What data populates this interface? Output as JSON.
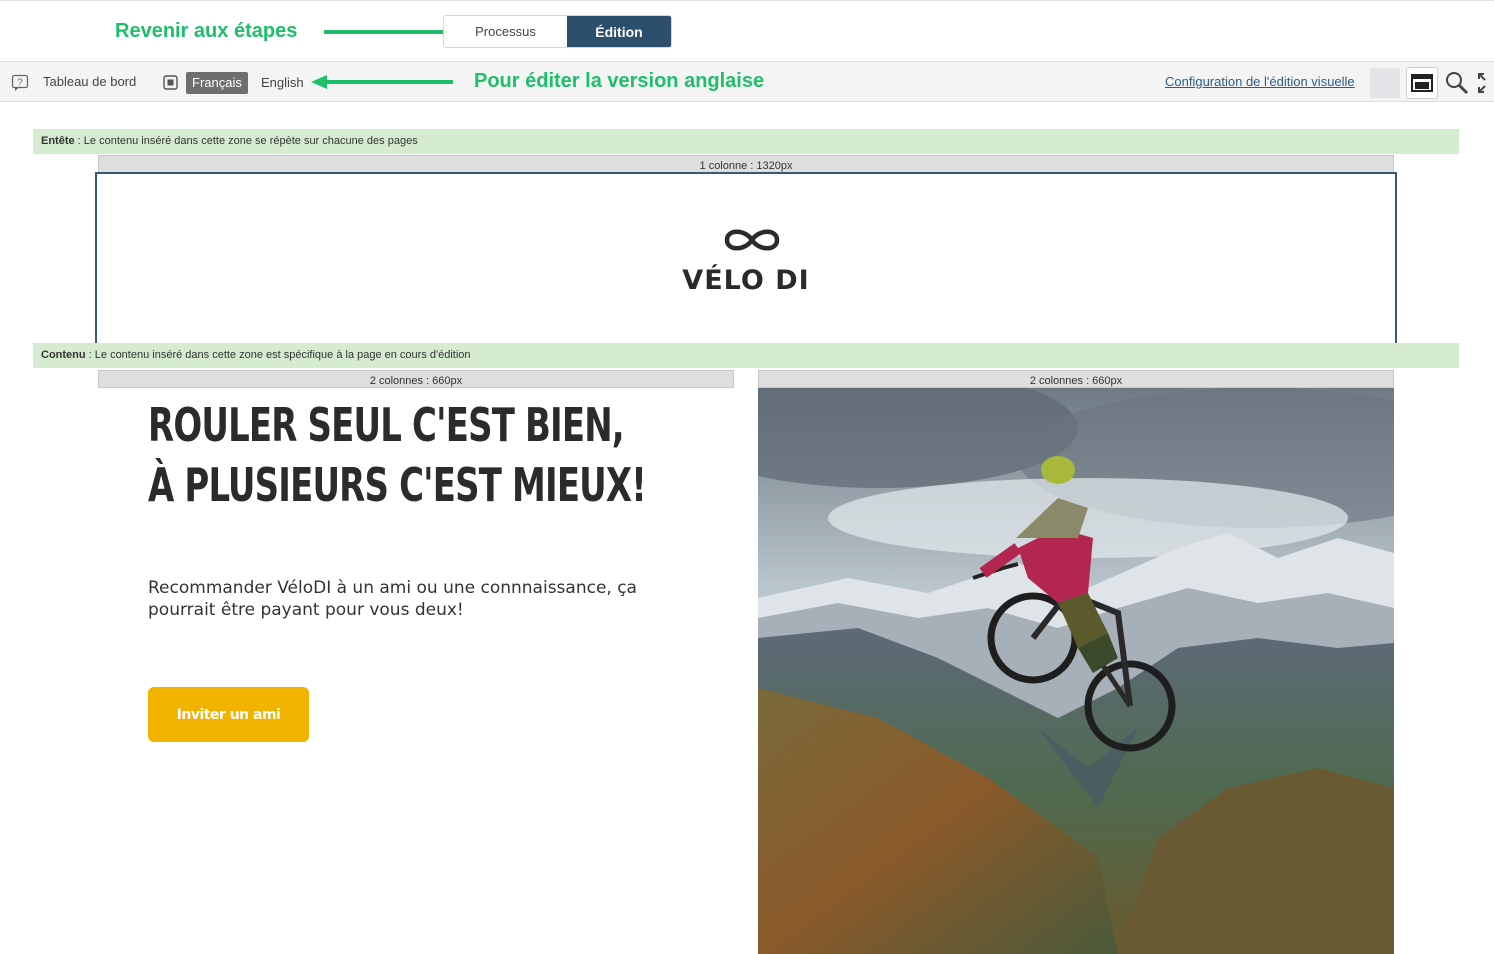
{
  "annotations": {
    "back_to_steps": "Revenir aux étapes",
    "edit_english": "Pour éditer la version anglaise",
    "color": "#1dbf6a"
  },
  "mode_switch": {
    "processus_label": "Processus",
    "edition_label": "Édition",
    "active": "Édition"
  },
  "toolbar": {
    "dashboard_label": "Tableau de bord",
    "languages": [
      "Français",
      "English"
    ],
    "active_language": "Français",
    "config_link": "Configuration de l'édition visuelle",
    "icons": [
      "help-icon",
      "language-icon",
      "window-preview-icon",
      "search-icon",
      "fullscreen-icon"
    ]
  },
  "header_zone": {
    "label_bold": "Entête",
    "label_rest": " : Le contenu inséré dans cette zone se répète sur chacune des pages",
    "column_label": "1 colonne : 1320px",
    "logo_text": "VÉLO DI",
    "logo_icon": "infinity-icon"
  },
  "content_zone": {
    "label_bold": "Contenu",
    "label_rest": " : Le contenu inséré dans cette zone est spécifique à la page en cours d'édition",
    "left_column_label": "2 colonnes : 660px",
    "right_column_label": "2 colonnes : 660px",
    "headline_line1": "ROULER SEUL C'EST BIEN,",
    "headline_line2": "À PLUSIEURS C'EST MIEUX!",
    "subtext": "Recommander VéloDI à un ami ou une connnaissance, ça pourrait être payant pour vous deux!",
    "cta_label": "Inviter un ami",
    "cta_color": "#f1b300"
  },
  "colors": {
    "edition_active": "#2c4f6e",
    "zone_bar": "#d5ecd0",
    "header_border": "#3d5873"
  }
}
